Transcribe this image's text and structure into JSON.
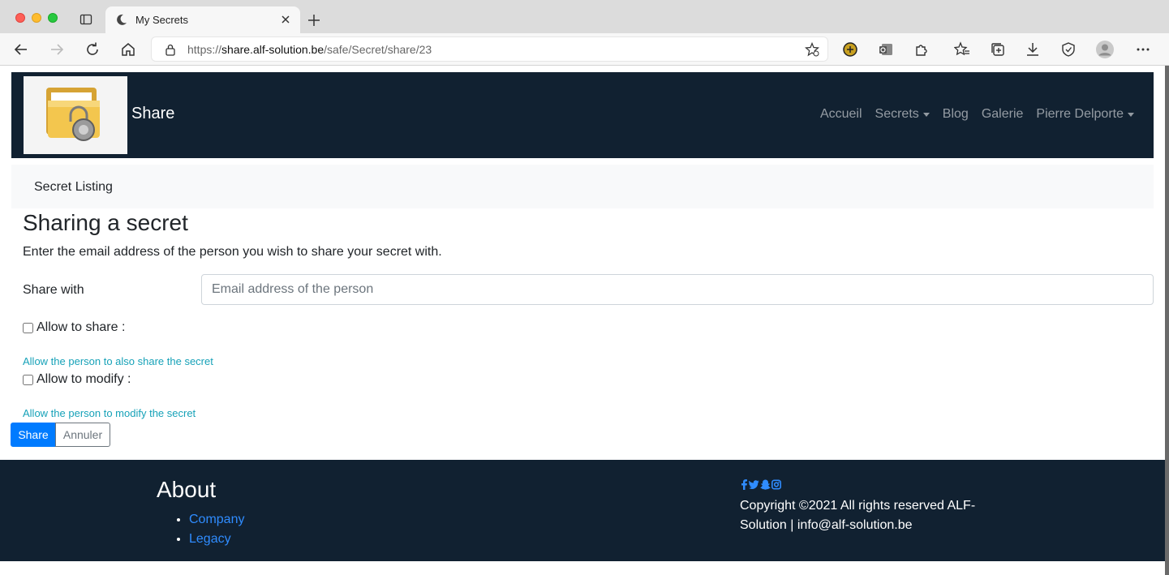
{
  "browser": {
    "tab_title": "My Secrets",
    "url_prefix": "https://",
    "url_host": "share.alf-solution.be",
    "url_path": "/safe/Secret/share/23"
  },
  "navbar": {
    "brand": "Share",
    "items": [
      {
        "label": "Accueil",
        "dropdown": false
      },
      {
        "label": "Secrets",
        "dropdown": true
      },
      {
        "label": "Blog",
        "dropdown": false
      },
      {
        "label": "Galerie",
        "dropdown": false
      },
      {
        "label": "Pierre Delporte",
        "dropdown": true
      }
    ]
  },
  "breadcrumb": {
    "item": "Secret Listing"
  },
  "form": {
    "title": "Sharing a secret",
    "lead": "Enter the email address of the person you wish to share your secret with.",
    "share_with_label": "Share with",
    "email_placeholder": "Email address of the person",
    "allow_share_label": "Allow to share :",
    "allow_share_help": "Allow the person to also share the secret",
    "allow_modify_label": "Allow to modify :",
    "allow_modify_help": "Allow the person to modify the secret",
    "share_button": "Share",
    "cancel_button": "Annuler"
  },
  "footer": {
    "heading": "About",
    "links": [
      "Company",
      "Legacy"
    ],
    "copyright": "Copyright ©2021 All rights reserved ALF-Solution | info@alf-solution.be"
  },
  "colors": {
    "navbar_bg": "#112131",
    "primary": "#007bff",
    "info": "#17a2b8",
    "link": "#2f8cff"
  }
}
